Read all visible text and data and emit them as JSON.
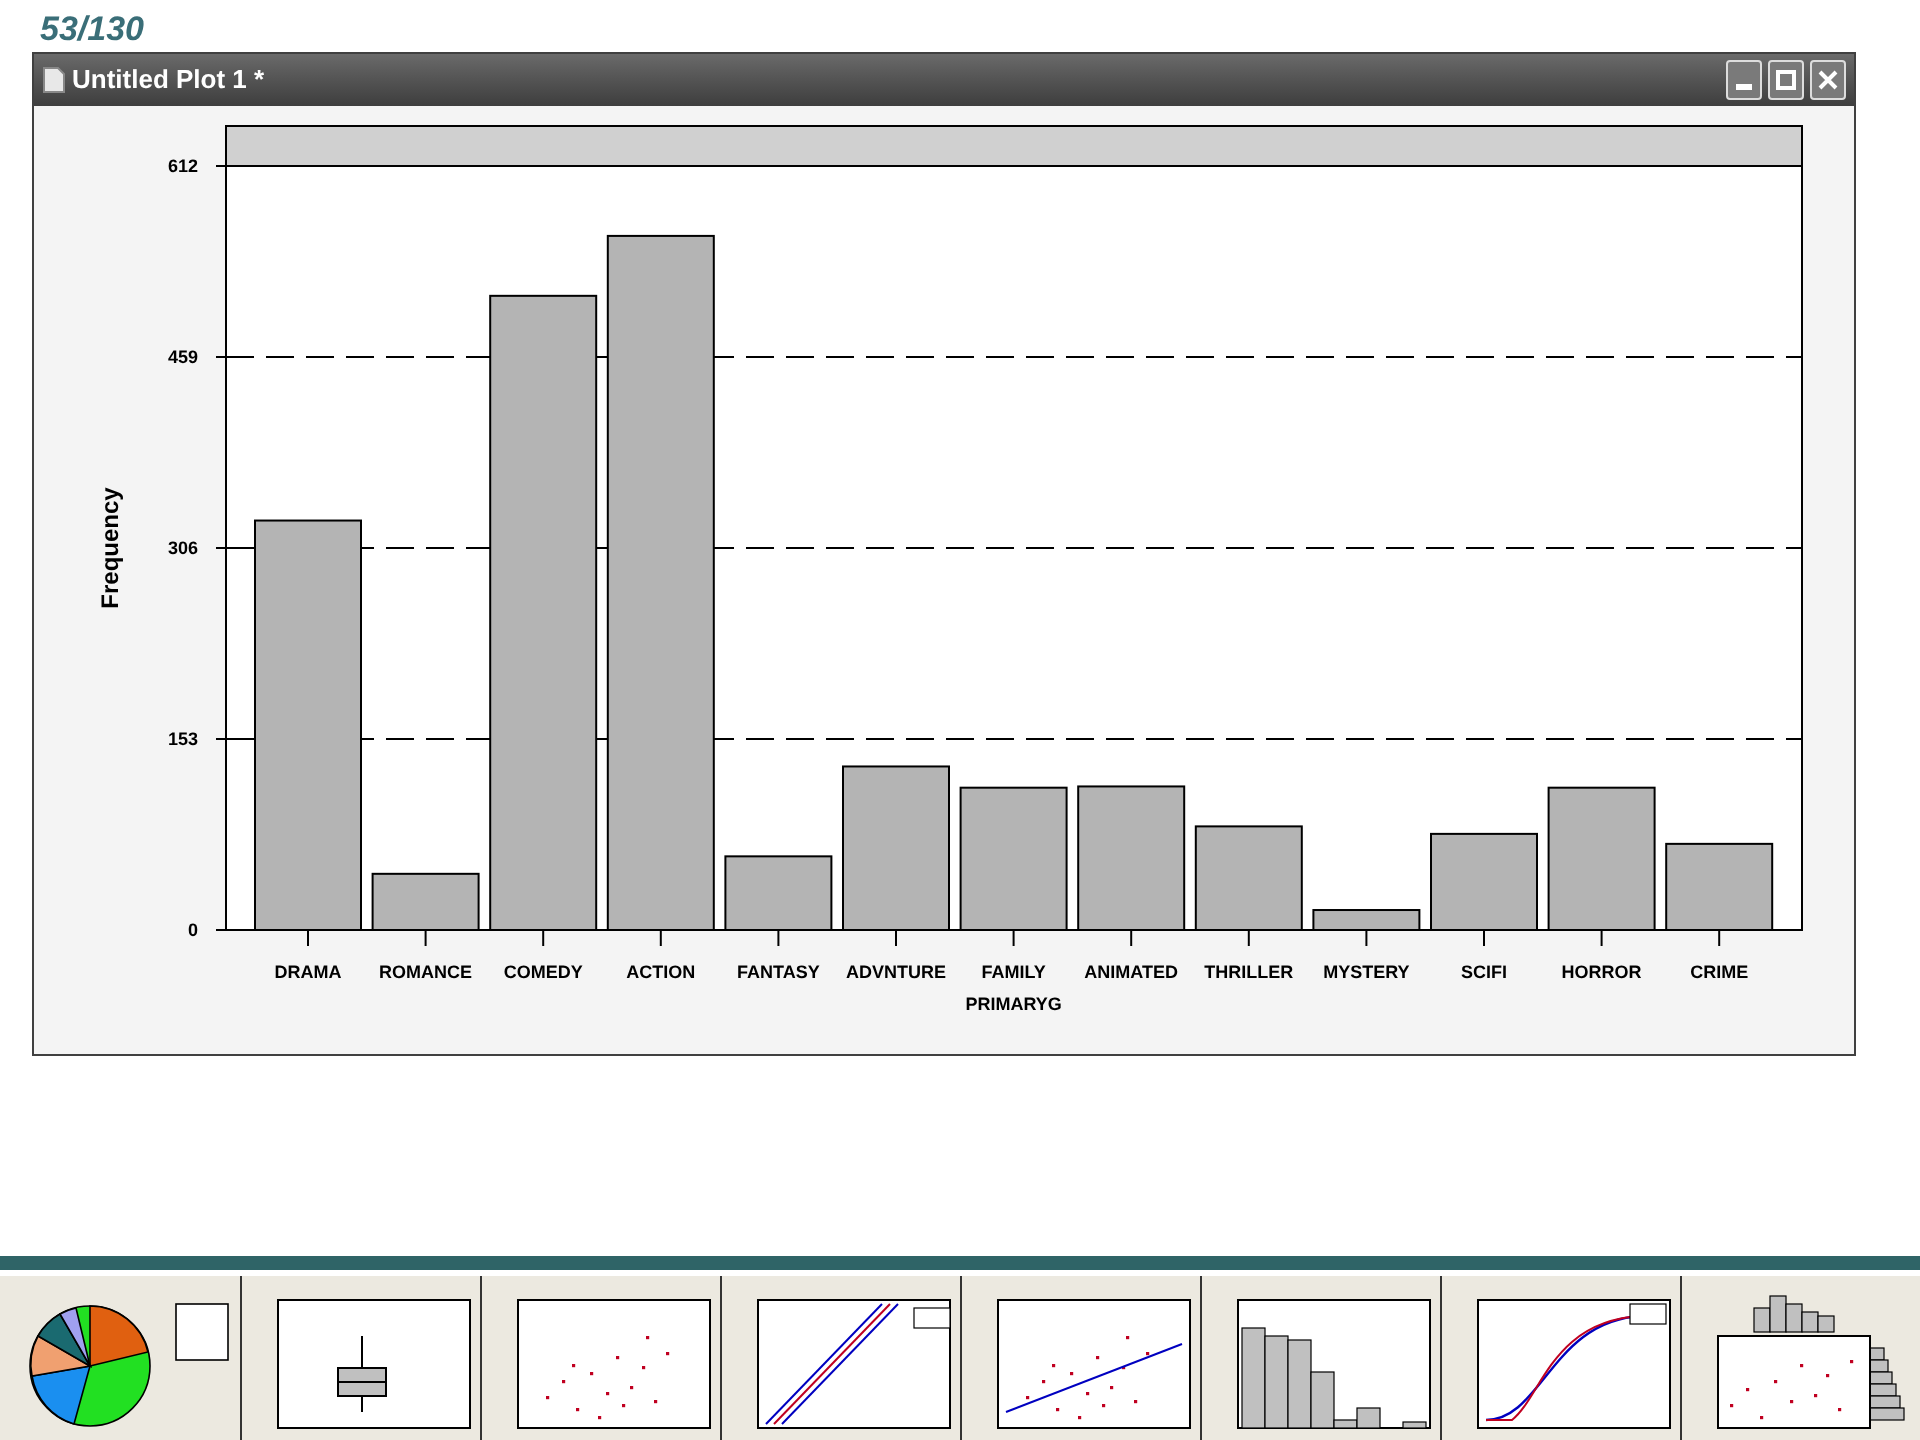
{
  "slide_number": "53/130",
  "window": {
    "title": "Untitled Plot 1 *"
  },
  "chart_data": {
    "type": "bar",
    "xlabel": "PRIMARYG",
    "ylabel": "Frequency",
    "categories": [
      "DRAMA",
      "ROMANCE",
      "COMEDY",
      "ACTION",
      "FANTASY",
      "ADVNTURE",
      "FAMILY",
      "ANIMATED",
      "THRILLER",
      "MYSTERY",
      "SCIFI",
      "HORROR",
      "CRIME"
    ],
    "values": [
      328,
      45,
      508,
      556,
      59,
      131,
      114,
      115,
      83,
      16,
      77,
      114,
      69
    ],
    "ylim": [
      0,
      612
    ],
    "grid": true,
    "yticks": [
      0,
      153,
      306,
      459,
      612
    ]
  },
  "thumbnails": [
    {
      "kind": "pie"
    },
    {
      "kind": "box"
    },
    {
      "kind": "scatter"
    },
    {
      "kind": "probability"
    },
    {
      "kind": "fit"
    },
    {
      "kind": "histogram"
    },
    {
      "kind": "cdf"
    },
    {
      "kind": "marginal"
    }
  ]
}
